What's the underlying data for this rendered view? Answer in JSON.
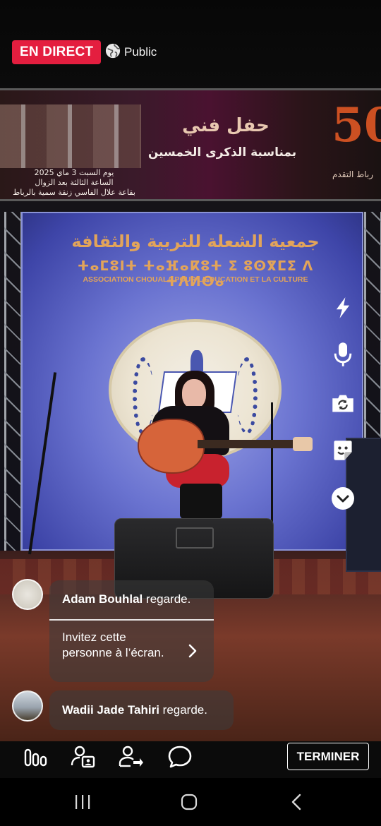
{
  "stream": {
    "live_label": "EN DIRECT",
    "privacy_label": "Public",
    "privacy_icon": "globe-icon",
    "live_color": "#e41e3f"
  },
  "scene": {
    "banner_title": "حفل فني",
    "banner_subtitle": "بمناسبة الذكرى الخمسين",
    "banner_date_line1": "يوم السبت 3 ماي 2025",
    "banner_date_line2": "الساعة الثالثة بعد الزوال",
    "banner_date_line3": "بقاعة علال الفاسي زنقة سمية بالرباط",
    "banner_number": "50",
    "banner_org_short": "رباط التقدم",
    "backdrop_arabic": "جمعية الشعلة للتربية والثقافة",
    "backdrop_tifinagh": "ⵜⴰⵎⵓⵏⵜ ⵜⴰⴼⴰⴽⵓⵜ ⵉ ⵓⵙⴳⵎⵉ ⴷ ⵜⴷⵍⵙⴰ",
    "backdrop_french": "ASSOCIATION CHOUALA POUR L'EDUCATION ET LA CULTURE"
  },
  "side_tools": [
    {
      "icon": "flash-icon"
    },
    {
      "icon": "microphone-icon"
    },
    {
      "icon": "flip-camera-icon"
    },
    {
      "icon": "face-effects-icon"
    },
    {
      "icon": "chevron-down-icon"
    }
  ],
  "comments": [
    {
      "name": "Adam Bouhlal",
      "action": "regarde.",
      "invite_text": "Invitez cette personne à l’écran."
    },
    {
      "name": "Wadii Jade Tahiri",
      "action": "regarde."
    }
  ],
  "bottom_bar": {
    "icons": [
      "stats-icon",
      "guest-icon",
      "add-guest-icon",
      "comment-icon"
    ],
    "end_label": "TERMINER"
  },
  "system_nav": {
    "icons": [
      "recent-apps-icon",
      "home-icon",
      "back-icon"
    ]
  }
}
